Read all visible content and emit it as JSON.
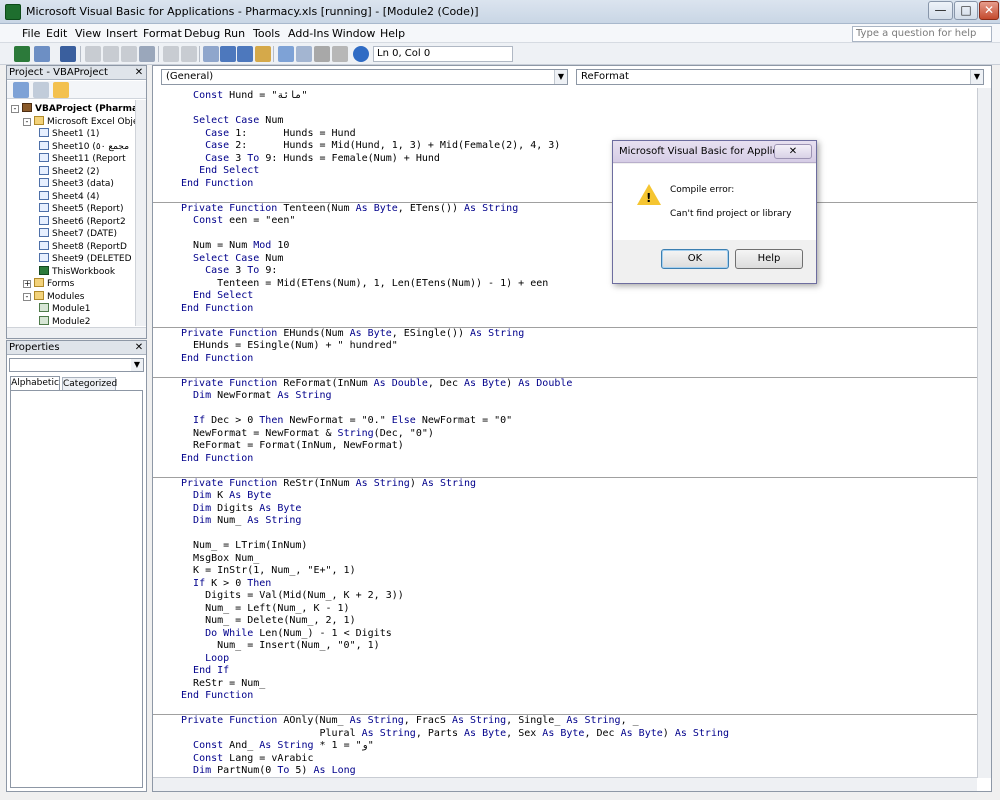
{
  "window": {
    "title": "Microsoft Visual Basic for Applications - Pharmacy.xls [running] - [Module2 (Code)]",
    "minimize": "—",
    "maximize": "□",
    "close": "✕"
  },
  "menu": {
    "items": [
      "File",
      "Edit",
      "View",
      "Insert",
      "Format",
      "Debug",
      "Run",
      "Tools",
      "Add-Ins",
      "Window",
      "Help"
    ],
    "help_placeholder": "Type a question for help"
  },
  "toolbar": {
    "position": "Ln 0, Col 0"
  },
  "project_panel": {
    "title": "Project - VBAProject",
    "close": "✕",
    "tree": [
      {
        "label": "VBAProject (Pharmac",
        "level": 0,
        "icon": "project",
        "expander": "-"
      },
      {
        "label": "Microsoft Excel Objec",
        "level": 1,
        "icon": "folder",
        "expander": "-"
      },
      {
        "label": "Sheet1 (1)",
        "level": 2,
        "icon": "sheet"
      },
      {
        "label": "Sheet10 (مجمع ٥٠",
        "level": 2,
        "icon": "sheet"
      },
      {
        "label": "Sheet11 (Report",
        "level": 2,
        "icon": "sheet"
      },
      {
        "label": "Sheet2 (2)",
        "level": 2,
        "icon": "sheet"
      },
      {
        "label": "Sheet3 (data)",
        "level": 2,
        "icon": "sheet"
      },
      {
        "label": "Sheet4 (4)",
        "level": 2,
        "icon": "sheet"
      },
      {
        "label": "Sheet5 (Report)",
        "level": 2,
        "icon": "sheet"
      },
      {
        "label": "Sheet6 (Report2",
        "level": 2,
        "icon": "sheet"
      },
      {
        "label": "Sheet7 (DATE)",
        "level": 2,
        "icon": "sheet"
      },
      {
        "label": "Sheet8 (ReportD",
        "level": 2,
        "icon": "sheet"
      },
      {
        "label": "Sheet9 (DELETED",
        "level": 2,
        "icon": "sheet"
      },
      {
        "label": "ThisWorkbook",
        "level": 2,
        "icon": "workbook"
      },
      {
        "label": "Forms",
        "level": 1,
        "icon": "folder",
        "expander": "+"
      },
      {
        "label": "Modules",
        "level": 1,
        "icon": "folder",
        "expander": "-"
      },
      {
        "label": "Module1",
        "level": 2,
        "icon": "module"
      },
      {
        "label": "Module2",
        "level": 2,
        "icon": "module"
      }
    ]
  },
  "properties_panel": {
    "title": "Properties",
    "close": "✕",
    "tabs": [
      "Alphabetic",
      "Categorized"
    ]
  },
  "code_window": {
    "object_combo": "(General)",
    "proc_combo": "ReFormat",
    "lines": [
      "  Const Hund = \"مائة\"",
      "",
      "  Select Case Num",
      "    Case 1:      Hunds = Hund",
      "    Case 2:      Hunds = Mid(Hund, 1, 3) + Mid(Female(2), 4, 3)",
      "    Case 3 To 9: Hunds = Female(Num) + Hund",
      "   End Select",
      "End Function",
      "",
      "Private Function Tenteen(Num As Byte, ETens()) As String",
      "  Const een = \"een\"",
      "",
      "  Num = Num Mod 10",
      "  Select Case Num",
      "    Case 3 To 9:",
      "      Tenteen = Mid(ETens(Num), 1, Len(ETens(Num)) - 1) + een",
      "  End Select",
      "End Function",
      "",
      "Private Function EHunds(Num As Byte, ESingle()) As String",
      "  EHunds = ESingle(Num) + \" hundred\"",
      "End Function",
      "",
      "Private Function ReFormat(InNum As Double, Dec As Byte) As Double",
      "  Dim NewFormat As String",
      "",
      "  If Dec > 0 Then NewFormat = \"0.\" Else NewFormat = \"0\"",
      "  NewFormat = NewFormat & String(Dec, \"0\")",
      "  ReFormat = Format(InNum, NewFormat)",
      "End Function",
      "",
      "Private Function ReStr(InNum As String) As String",
      "  Dim K As Byte",
      "  Dim Digits As Byte",
      "  Dim Num_ As String",
      "",
      "  Num_ = LTrim(InNum)",
      "  MsgBox Num_",
      "  K = InStr(1, Num_, \"E+\", 1)",
      "  If K > 0 Then",
      "    Digits = Val(Mid(Num_, K + 2, 3))",
      "    Num_ = Left(Num_, K - 1)",
      "    Num_ = Delete(Num_, 2, 1)",
      "    Do While Len(Num_) - 1 < Digits",
      "      Num_ = Insert(Num_, \"0\", 1)",
      "    Loop",
      "  End If",
      "  ReStr = Num_",
      "End Function",
      "",
      "Private Function AOnly(Num_ As String, FracS As String, Single_ As String, _",
      "                       Plural As String, Parts As Byte, Sex As Byte, Dec As Byte) As String",
      "  Const And_ As String * 1 = \"و\"",
      "  Const Lang = vArabic",
      "  Dim PartNum(0 To 5) As Long"
    ]
  },
  "dialog": {
    "title": "Microsoft Visual Basic for Applicati...",
    "close": "✕",
    "heading": "Compile error:",
    "message": "Can't find project or library",
    "ok": "OK",
    "help": "Help"
  }
}
